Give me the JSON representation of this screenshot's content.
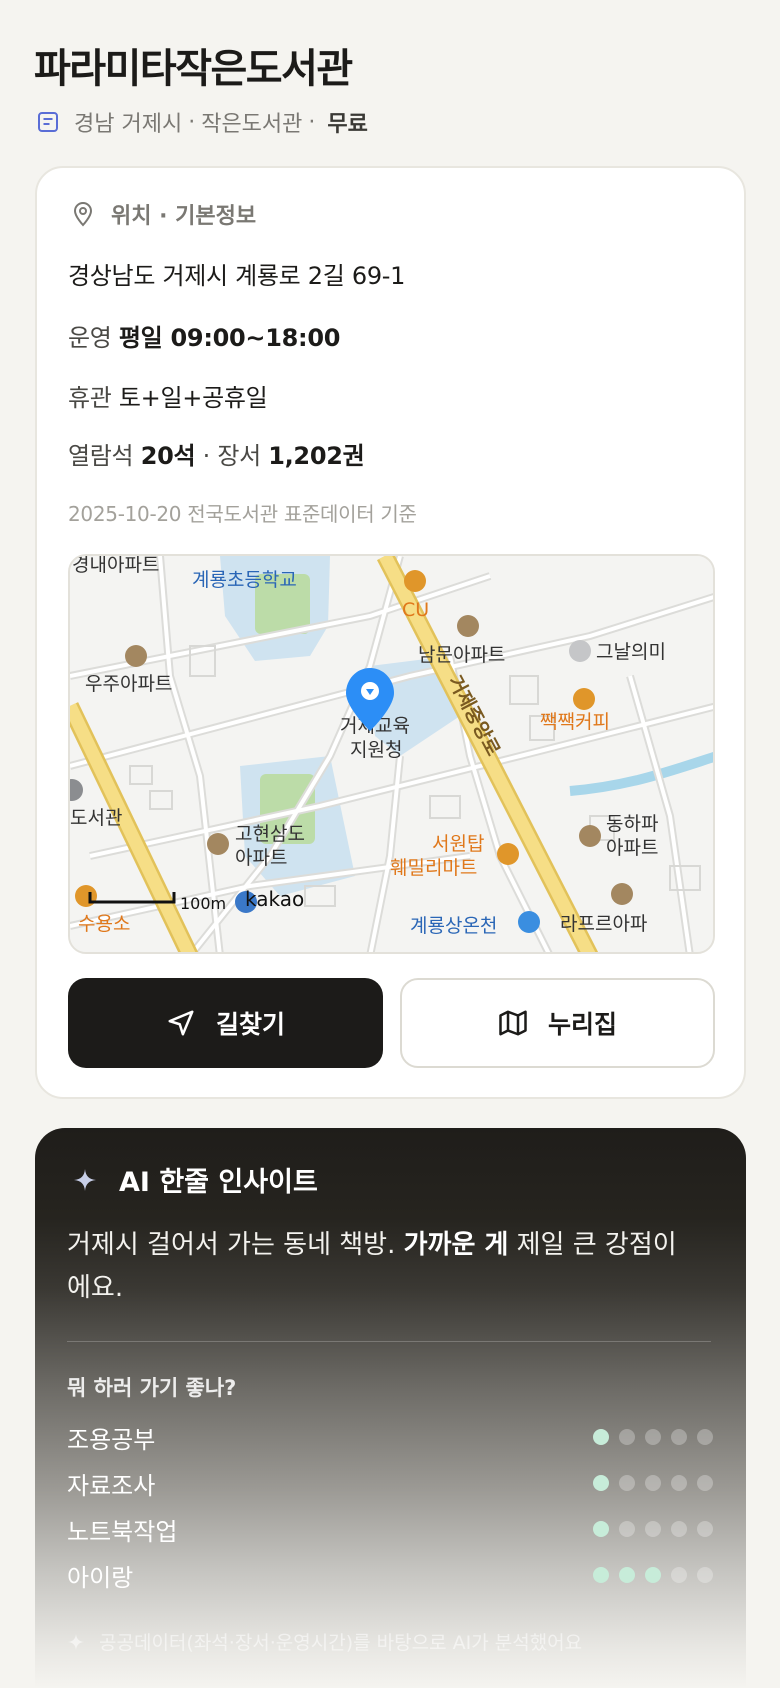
{
  "header": {
    "title": "파라미타작은도서관",
    "region": "경남 거제시",
    "type": "작은도서관",
    "separator": "·",
    "fee": "무료"
  },
  "info": {
    "section_title": "위치 · 기본정보",
    "address": "경상남도 거제시 계룡로 2길 69-1",
    "hours_label": "운영",
    "hours_value": "평일 09:00~18:00",
    "closed_label": "휴관",
    "closed_value": "토+일+공휴일",
    "seats_label": "열람석",
    "seats_value": "20석",
    "books_label": "장서",
    "books_value": "1,202권",
    "source": "2025-10-20 전국도서관 표준데이터 기준"
  },
  "map": {
    "labels": {
      "a1": "경내아파트",
      "a2": "계룡초등학교",
      "a3": "CU",
      "a4": "남문아파트",
      "a5": "그날의미",
      "a6": "우주아파트",
      "a7": "거제중앙로",
      "a8": "짹짹커피",
      "a9": "거제교육",
      "a10": "지원청",
      "a11": "도서관",
      "a12": "고현삼도",
      "a13": "아파트",
      "a14": "서원탑",
      "a15": "훼밀리마트",
      "a16": "동하파",
      "a17": "아파트",
      "a18": "라프르아파",
      "a19": "계룡상온천",
      "a20": "수용소"
    },
    "scale": "100m",
    "brand": "kakao"
  },
  "buttons": {
    "directions": "길찾기",
    "website": "누리집"
  },
  "ai": {
    "title": "AI 한줄 인사이트",
    "text_pre": "거제시 걸어서 가는 동네 책방. ",
    "text_bold": "가까운 게",
    "text_post": " 제일 큰 강점이에요.",
    "question": "뭐 하러 가기 좋나?",
    "activities": [
      {
        "name": "조용공부",
        "score": 1,
        "max": 5
      },
      {
        "name": "자료조사",
        "score": 1,
        "max": 5
      },
      {
        "name": "노트북작업",
        "score": 1,
        "max": 5
      },
      {
        "name": "아이랑",
        "score": 3,
        "max": 5
      }
    ],
    "footnote": "공공데이터(좌석·장서·운영시간)를 바탕으로 AI가 분석했어요"
  },
  "colors": {
    "accent_dark": "#1c1b19",
    "rating_on": "#c7ecd9",
    "map_pin": "#2c8ef6",
    "map_road_major": "#f3d56b",
    "map_poi_orange": "#e0781b",
    "map_poi_blue": "#2a66b6"
  }
}
